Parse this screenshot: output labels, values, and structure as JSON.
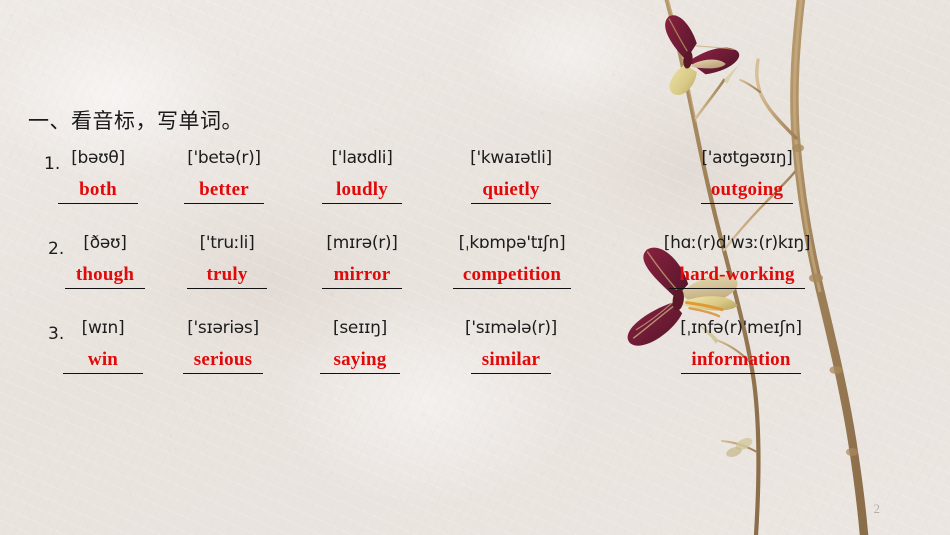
{
  "slide": {
    "title": "一、看音标，写单词。",
    "page_number": "2",
    "accent_color": "#e00a0a",
    "background_color": "#ebe5e1",
    "text_color": "#1c1c1c"
  },
  "exercise": {
    "rows": [
      {
        "number": "1.",
        "items": [
          {
            "phonetic": "[bəʊθ]",
            "answer": "both"
          },
          {
            "phonetic": "['betə(r)]",
            "answer": "better"
          },
          {
            "phonetic": "['laʊdli]",
            "answer": "loudly"
          },
          {
            "phonetic": "['kwaɪətli]",
            "answer": "quietly"
          },
          {
            "phonetic": "['aʊtgəʊɪŋ]",
            "answer": "outgoing"
          }
        ]
      },
      {
        "number": "2.",
        "items": [
          {
            "phonetic": "[ðəʊ]",
            "answer": "though"
          },
          {
            "phonetic": "['truːli]",
            "answer": "truly"
          },
          {
            "phonetic": "[mɪrə(r)]",
            "answer": "mirror"
          },
          {
            "phonetic": "[ˌkɒmpə'tɪʃn]",
            "answer": "competition"
          },
          {
            "phonetic": "[hɑː(r)d'wɜː(r)kɪŋ]",
            "answer": "hard-working"
          }
        ]
      },
      {
        "number": "3.",
        "items": [
          {
            "phonetic": "[wɪn]",
            "answer": "win"
          },
          {
            "phonetic": "['sɪəriəs]",
            "answer": "serious"
          },
          {
            "phonetic": "[seɪɪŋ]",
            "answer": "saying"
          },
          {
            "phonetic": "['sɪmələ(r)]",
            "answer": "similar"
          },
          {
            "phonetic": "[ˌɪnfə(r)'meɪʃn]",
            "answer": "information"
          }
        ]
      }
    ]
  },
  "decoration": {
    "description": "dried-branch-and-pressed-butterfly-photo"
  }
}
